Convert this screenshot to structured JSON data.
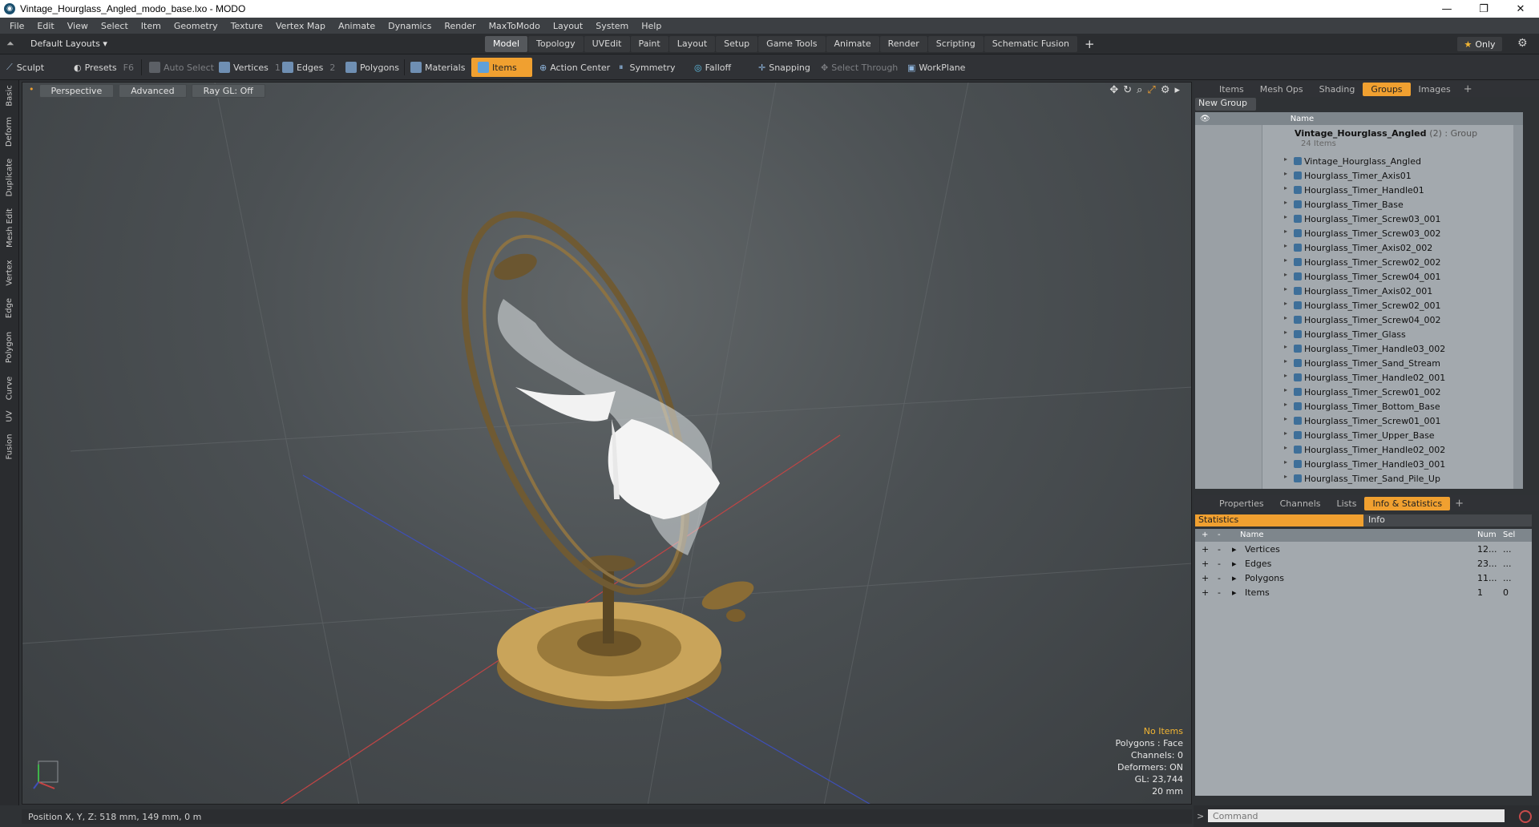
{
  "window": {
    "title": "Vintage_Hourglass_Angled_modo_base.lxo - MODO"
  },
  "menubar": [
    "File",
    "Edit",
    "View",
    "Select",
    "Item",
    "Geometry",
    "Texture",
    "Vertex Map",
    "Animate",
    "Dynamics",
    "Render",
    "MaxToModo",
    "Layout",
    "System",
    "Help"
  ],
  "layout": {
    "preset": "Default Layouts",
    "tabs": [
      "Model",
      "Topology",
      "UVEdit",
      "Paint",
      "Layout",
      "Setup",
      "Game Tools",
      "Animate",
      "Render",
      "Scripting",
      "Schematic Fusion"
    ],
    "active_tab": "Model",
    "only_label": "Only"
  },
  "toolbar": {
    "sculpt": "Sculpt",
    "presets": "Presets",
    "presets_key": "F6",
    "auto_select": "Auto Select",
    "vertices": "Vertices",
    "vertices_key": "1",
    "edges": "Edges",
    "edges_key": "2",
    "polygons": "Polygons",
    "materials": "Materials",
    "items": "Items",
    "action_center": "Action Center",
    "symmetry": "Symmetry",
    "falloff": "Falloff",
    "snapping": "Snapping",
    "select_through": "Select Through",
    "workplane": "WorkPlane"
  },
  "left_tabs": [
    "Basic",
    "Deform",
    "Duplicate",
    "Mesh Edit",
    "Vertex",
    "Edge",
    "Polygon",
    "Curve",
    "UV",
    "Fusion"
  ],
  "viewport": {
    "view": "Perspective",
    "shading": "Advanced",
    "raygl": "Ray GL: Off",
    "hud": {
      "selection": "No Items",
      "polygons": "Polygons : Face",
      "channels": "Channels: 0",
      "deformers": "Deformers: ON",
      "gl": "GL: 23,744",
      "unit": "20 mm"
    }
  },
  "status": {
    "position": "Position X, Y, Z:  518 mm, 149 mm, 0 m"
  },
  "right_top": {
    "tabs": [
      "Items",
      "Mesh Ops",
      "Shading",
      "Groups",
      "Images"
    ],
    "active_tab": "Groups",
    "new_group": "New Group",
    "col_name": "Name",
    "group": {
      "name": "Vintage_Hourglass_Angled",
      "meta": "(2) : Group",
      "count": "24 Items"
    },
    "items": [
      "Vintage_Hourglass_Angled",
      "Hourglass_Timer_Axis01",
      "Hourglass_Timer_Handle01",
      "Hourglass_Timer_Base",
      "Hourglass_Timer_Screw03_001",
      "Hourglass_Timer_Screw03_002",
      "Hourglass_Timer_Axis02_002",
      "Hourglass_Timer_Screw02_002",
      "Hourglass_Timer_Screw04_001",
      "Hourglass_Timer_Axis02_001",
      "Hourglass_Timer_Screw02_001",
      "Hourglass_Timer_Screw04_002",
      "Hourglass_Timer_Glass",
      "Hourglass_Timer_Handle03_002",
      "Hourglass_Timer_Sand_Stream",
      "Hourglass_Timer_Handle02_001",
      "Hourglass_Timer_Screw01_002",
      "Hourglass_Timer_Bottom_Base",
      "Hourglass_Timer_Screw01_001",
      "Hourglass_Timer_Upper_Base",
      "Hourglass_Timer_Handle02_002",
      "Hourglass_Timer_Handle03_001",
      "Hourglass_Timer_Sand_Pile_Up"
    ]
  },
  "right_bottom": {
    "tabs": [
      "Properties",
      "Channels",
      "Lists",
      "Info & Statistics"
    ],
    "active_tab": "Info & Statistics",
    "sub_tabs": [
      "Statistics",
      "Info"
    ],
    "col_name": "Name",
    "col_num": "Num",
    "col_sel": "Sel",
    "rows": [
      {
        "name": "Vertices",
        "num": "12...",
        "sel": "..."
      },
      {
        "name": "Edges",
        "num": "23...",
        "sel": "..."
      },
      {
        "name": "Polygons",
        "num": "11...",
        "sel": "..."
      },
      {
        "name": "Items",
        "num": "1",
        "sel": "0"
      }
    ]
  },
  "command": {
    "placeholder": "Command"
  },
  "colors": {
    "accent": "#f0a030",
    "panel": "#a3a9ae",
    "viewport": "#4b5053"
  }
}
